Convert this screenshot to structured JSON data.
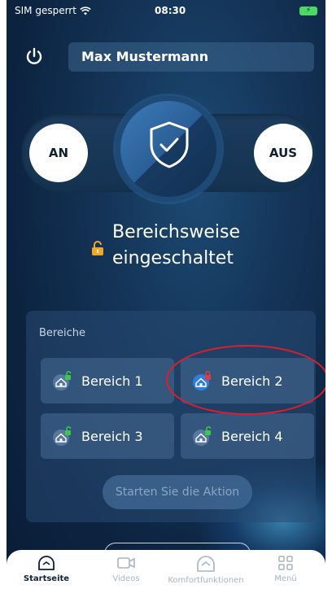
{
  "status_bar": {
    "carrier": "SIM gesperrt",
    "time": "08:30",
    "wifi_icon": "wifi-icon",
    "battery_icon": "battery-charging-icon"
  },
  "header": {
    "user_name": "Max Mustermann",
    "power_icon": "power-icon"
  },
  "arm_toggle": {
    "on_label": "AN",
    "off_label": "AUS",
    "center_icon": "shield-check-icon"
  },
  "system_status": {
    "line1": "Bereichsweise",
    "line2": "eingeschaltet",
    "icon": "lock-open-icon",
    "icon_color": "#f5a623"
  },
  "areas": {
    "title": "Bereiche",
    "items": [
      {
        "label": "Bereich 1",
        "state": "disarmed",
        "icon": "home-unlocked-icon"
      },
      {
        "label": "Bereich 2",
        "state": "armed",
        "icon": "home-locked-icon"
      },
      {
        "label": "Bereich 3",
        "state": "disarmed",
        "icon": "home-unlocked-icon"
      },
      {
        "label": "Bereich 4",
        "state": "disarmed",
        "icon": "home-unlocked-icon"
      }
    ],
    "action_button": "Starten Sie die Aktion"
  },
  "tabs": [
    {
      "label": "Startseite",
      "icon": "home-icon",
      "active": true
    },
    {
      "label": "Videos",
      "icon": "video-camera-icon",
      "active": false
    },
    {
      "label": "Komfortfunktionen",
      "icon": "comfort-home-icon",
      "active": false
    },
    {
      "label": "Menü",
      "icon": "grid-menu-icon",
      "active": false
    }
  ],
  "colors": {
    "background": "#143457",
    "lock_open_green": "#3cc84a",
    "lock_closed_red": "#e63946",
    "armed_icon_blue": "#2f80d8",
    "highlight_red": "#e11d2a"
  }
}
